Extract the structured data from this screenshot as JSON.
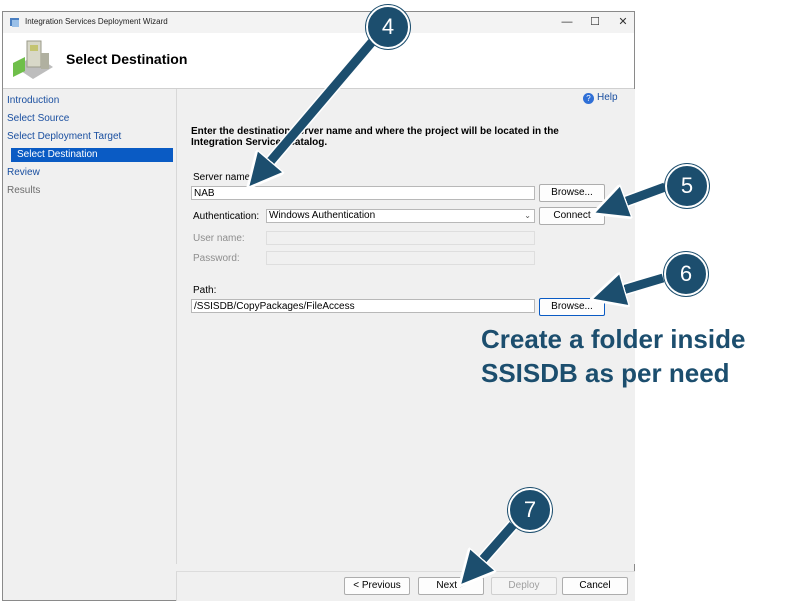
{
  "window": {
    "title": "Integration Services Deployment Wizard",
    "controls": {
      "minimize": "—",
      "maximize": "☐",
      "close": "✕"
    }
  },
  "header": {
    "title": "Select Destination"
  },
  "nav": {
    "items": [
      {
        "label": "Introduction",
        "state": "link"
      },
      {
        "label": "Select Source",
        "state": "link"
      },
      {
        "label": "Select Deployment Target",
        "state": "link"
      },
      {
        "label": "Select Destination",
        "state": "selected"
      },
      {
        "label": "Review",
        "state": "link"
      },
      {
        "label": "Results",
        "state": "disabled"
      }
    ]
  },
  "content": {
    "help_label": "Help",
    "instructions": "Enter the destination server name and where the project will be located in the Integration Services catalog.",
    "server_name_label": "Server name:",
    "server_name_value": "NAB",
    "browse_label": "Browse...",
    "authentication_label": "Authentication:",
    "authentication_value": "Windows Authentication",
    "connect_label": "Connect",
    "user_name_label": "User name:",
    "password_label": "Password:",
    "path_label": "Path:",
    "path_value": "/SSISDB/CopyPackages/FileAccess",
    "path_browse_label": "Browse..."
  },
  "footer": {
    "previous": "< Previous",
    "next": "Next >",
    "deploy": "Deploy",
    "cancel": "Cancel"
  },
  "annotations": {
    "callouts": [
      "4",
      "5",
      "6",
      "7"
    ],
    "note_line1": "Create a folder inside",
    "note_line2": "SSISDB as per need",
    "color": "#1c4e6e"
  }
}
